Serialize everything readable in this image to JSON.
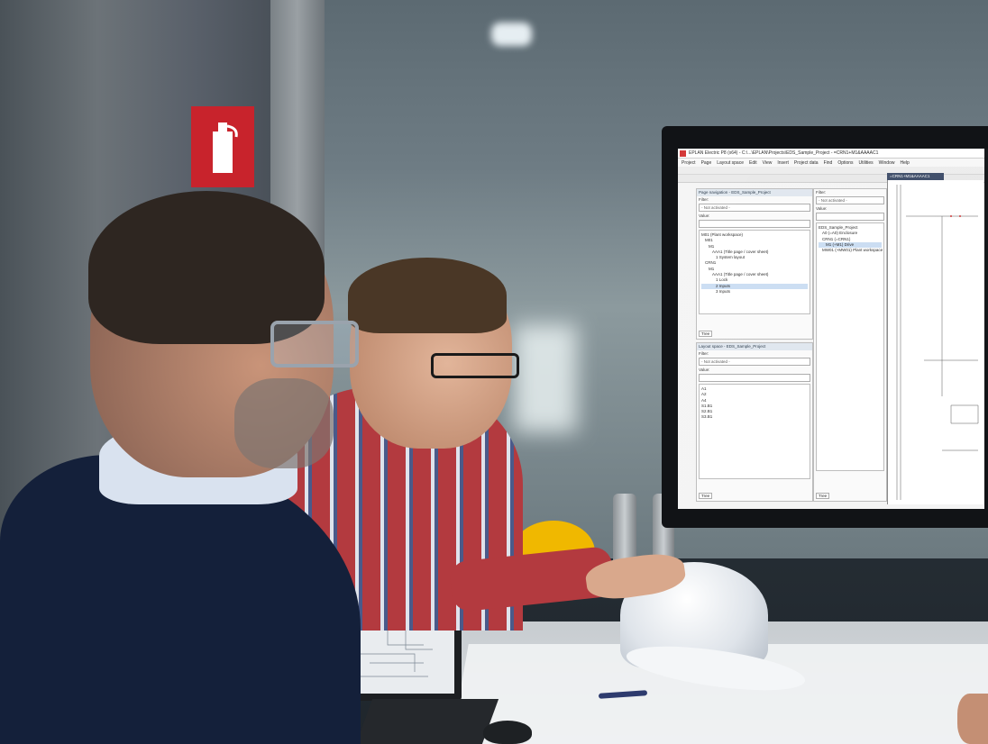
{
  "monitor_ui": {
    "window_title": "EPLAN Electric P8 (x64) - C:\\...\\EPLAN\\Projects\\EDS_Sample_Project - =CRN1+M1&AAAAC1",
    "menu_items": [
      "Project",
      "Page",
      "Layout space",
      "Edit",
      "View",
      "Insert",
      "Project data",
      "Find",
      "Options",
      "Utilities",
      "Window",
      "Help"
    ],
    "page_nav_pane": {
      "title": "Page navigation - EDS_Sample_Project",
      "filter_label": "Filter:",
      "filter_value": "- Not activated -",
      "value_label": "Value:",
      "tree": [
        "M01 (Plant workspace)",
        "M01",
        "M1",
        "AAA1 (Title page / cover sheet)",
        "1 System layout",
        "CRN1",
        "M1",
        "AAA1 (Title page / cover sheet)",
        "1 Lock",
        "2 Inputs",
        "3 Inputs"
      ],
      "selected_index": 9,
      "footer": "Tree"
    },
    "layout_pane": {
      "title": "Layout space - EDS_Sample_Project",
      "filter_label": "Filter:",
      "filter_value": "- Not activated -",
      "value_label": "Value:",
      "tree": [
        "A1",
        "A2",
        "A4",
        "S1.B1",
        "S2.B1",
        "S3.B1"
      ],
      "footer": "Tree"
    },
    "device_pane": {
      "filter_label": "Filter:",
      "filter_value": "- Not activated -",
      "value_label": "Value:",
      "tree": [
        "EDS_Sample_Project",
        "A0 (=A0) Enclosure",
        "CRN1 (=CRN1)",
        "M1 (+M1) Drive",
        "MW01 (+MW01) Plant workspace"
      ],
      "footer": "Tree"
    },
    "active_tab": "=CRN1+M1&AAAAC1"
  },
  "colors": {
    "extinguisher_sign": "#c8232c",
    "helmet_yellow": "#f0b800",
    "helmet_white": "#eef1f5",
    "shirt_plaid_red": "#b33a3f",
    "sweater_navy": "#14203a"
  }
}
